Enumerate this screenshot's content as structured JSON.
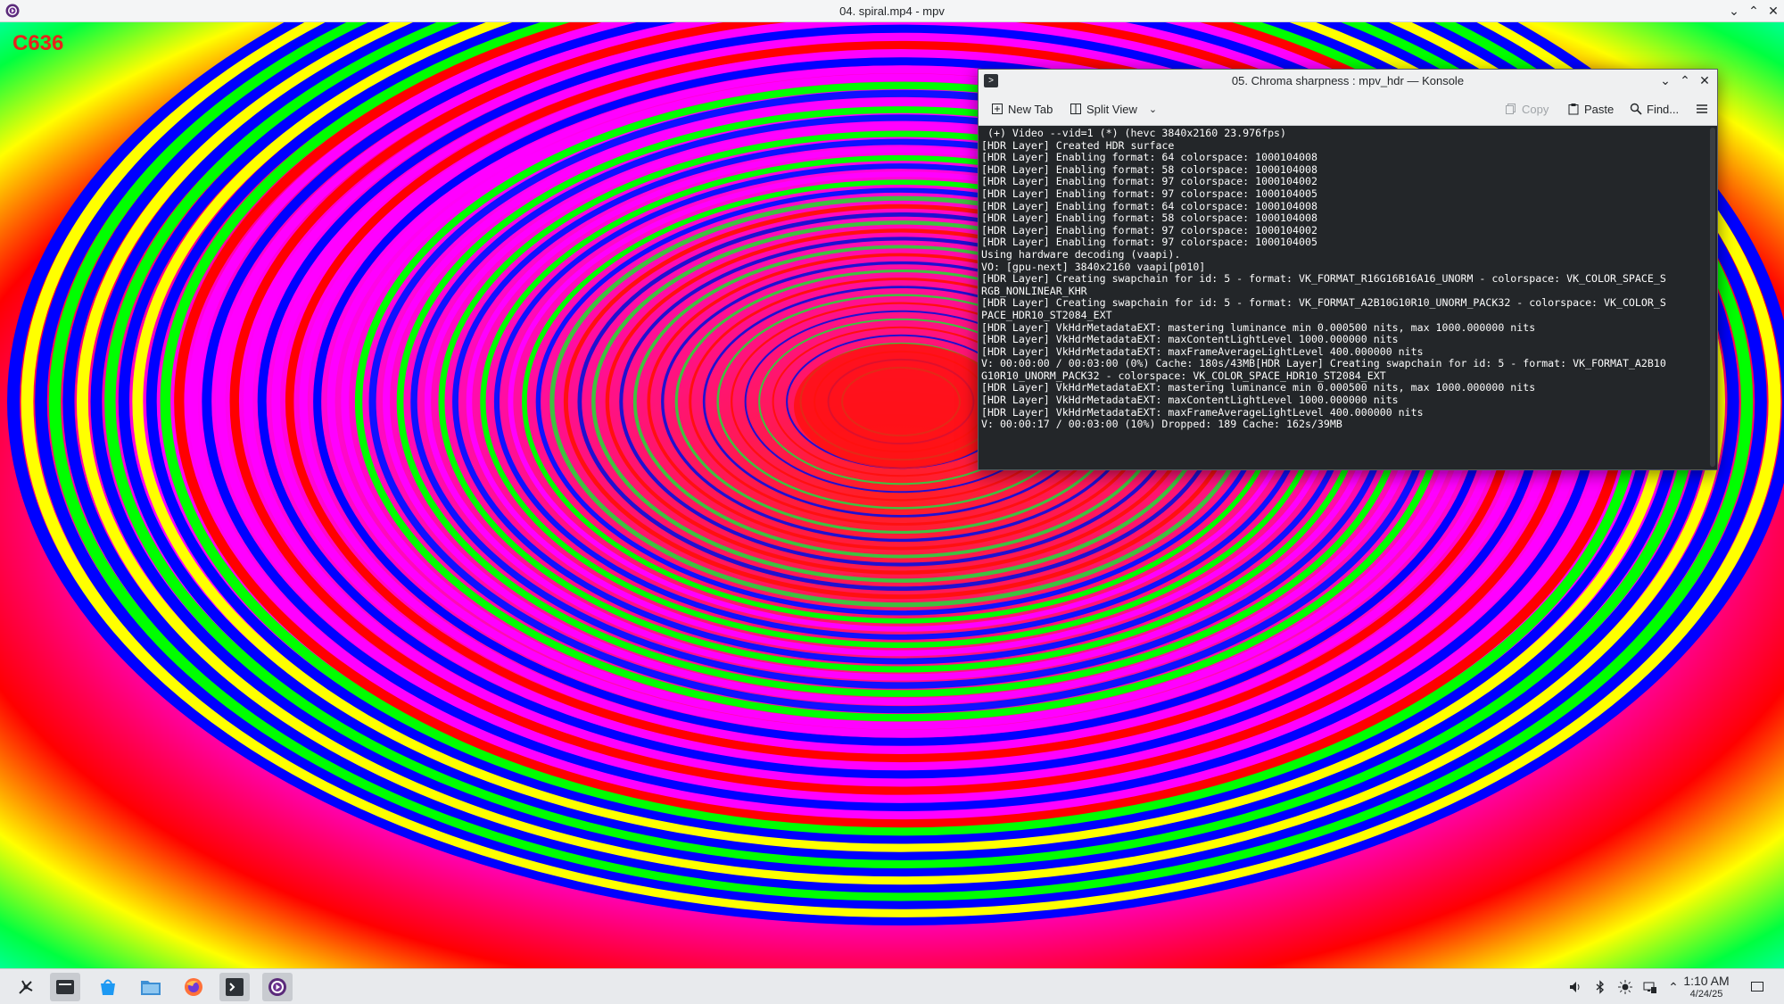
{
  "mpv_window": {
    "title": "04. spiral.mp4 - mpv",
    "overlay_code": "C636"
  },
  "konsole": {
    "title": "05. Chroma sharpness : mpv_hdr — Konsole",
    "toolbar": {
      "new_tab": "New Tab",
      "split_view": "Split View",
      "copy": "Copy",
      "paste": "Paste",
      "find": "Find..."
    },
    "terminal_lines": [
      " (+) Video --vid=1 (*) (hevc 3840x2160 23.976fps)",
      "[HDR Layer] Created HDR surface",
      "[HDR Layer] Enabling format: 64 colorspace: 1000104008",
      "[HDR Layer] Enabling format: 58 colorspace: 1000104008",
      "[HDR Layer] Enabling format: 97 colorspace: 1000104002",
      "[HDR Layer] Enabling format: 97 colorspace: 1000104005",
      "[HDR Layer] Enabling format: 64 colorspace: 1000104008",
      "[HDR Layer] Enabling format: 58 colorspace: 1000104008",
      "[HDR Layer] Enabling format: 97 colorspace: 1000104002",
      "[HDR Layer] Enabling format: 97 colorspace: 1000104005",
      "Using hardware decoding (vaapi).",
      "VO: [gpu-next] 3840x2160 vaapi[p010]",
      "[HDR Layer] Creating swapchain for id: 5 - format: VK_FORMAT_R16G16B16A16_UNORM - colorspace: VK_COLOR_SPACE_S",
      "RGB_NONLINEAR_KHR",
      "[HDR Layer] Creating swapchain for id: 5 - format: VK_FORMAT_A2B10G10R10_UNORM_PACK32 - colorspace: VK_COLOR_S",
      "PACE_HDR10_ST2084_EXT",
      "[HDR Layer] VkHdrMetadataEXT: mastering luminance min 0.000500 nits, max 1000.000000 nits",
      "[HDR Layer] VkHdrMetadataEXT: maxContentLightLevel 1000.000000 nits",
      "[HDR Layer] VkHdrMetadataEXT: maxFrameAverageLightLevel 400.000000 nits",
      "V: 00:00:00 / 00:03:00 (0%) Cache: 180s/43MB[HDR Layer] Creating swapchain for id: 5 - format: VK_FORMAT_A2B10",
      "G10R10_UNORM_PACK32 - colorspace: VK_COLOR_SPACE_HDR10_ST2084_EXT",
      "[HDR Layer] VkHdrMetadataEXT: mastering luminance min 0.000500 nits, max 1000.000000 nits",
      "[HDR Layer] VkHdrMetadataEXT: maxContentLightLevel 1000.000000 nits",
      "[HDR Layer] VkHdrMetadataEXT: maxFrameAverageLightLevel 400.000000 nits",
      "V: 00:00:17 / 00:03:00 (10%) Dropped: 189 Cache: 162s/39MB"
    ]
  },
  "taskbar": {
    "items": [
      "application-launcher-icon",
      "pager-icon",
      "discover-icon",
      "file-manager-icon",
      "firefox-icon",
      "konsole-icon",
      "mpv-icon"
    ],
    "tray": [
      "volume-icon",
      "bluetooth-icon",
      "brightness-icon",
      "network-icon",
      "expand-tray-icon"
    ],
    "clock_time": "1:10 AM",
    "clock_date": "4/24/25"
  },
  "colors": {
    "spiral": [
      "#0000ff",
      "#00ff00",
      "#ff00ff",
      "#ff0000",
      "#ffff00"
    ],
    "terminal_bg": "#232629",
    "overlay_text": "#e8221c"
  }
}
